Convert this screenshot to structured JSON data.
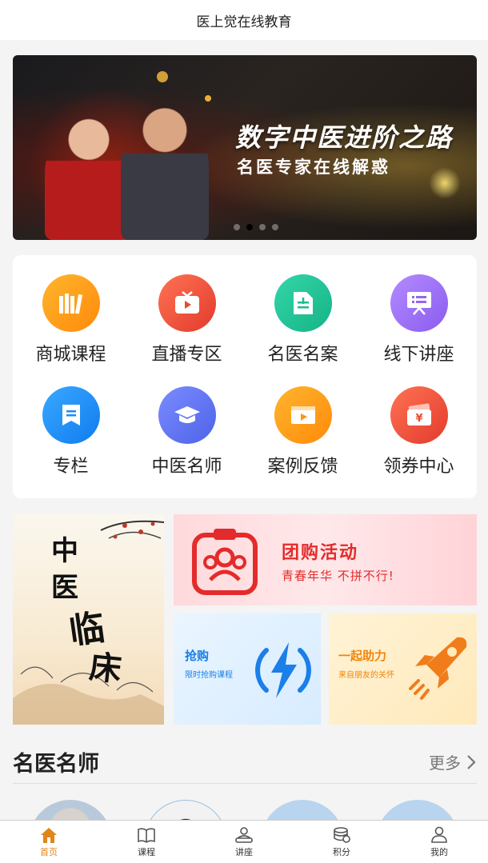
{
  "header": {
    "title": "医上觉在线教育"
  },
  "banner": {
    "line1": "数字中医进阶之路",
    "line2": "名医专家在线解惑",
    "slide_count": 4,
    "active_slide": 2
  },
  "menu": {
    "items": [
      {
        "label": "商城课程",
        "icon": "books-icon",
        "color": "#ff9e1b"
      },
      {
        "label": "直播专区",
        "icon": "tv-icon",
        "color": "#f0553d"
      },
      {
        "label": "名医名案",
        "icon": "document-icon",
        "color": "#22c49a"
      },
      {
        "label": "线下讲座",
        "icon": "presentation-icon",
        "color": "#9b6cf0"
      },
      {
        "label": "专栏",
        "icon": "column-icon",
        "color": "#1e90ff"
      },
      {
        "label": "中医名师",
        "icon": "graduation-cap-icon",
        "color": "#5b72f0"
      },
      {
        "label": "案例反馈",
        "icon": "video-play-icon",
        "color": "#ff9e1b"
      },
      {
        "label": "领券中心",
        "icon": "coupon-icon",
        "color": "#f0553d"
      }
    ]
  },
  "promos": {
    "clinic": {
      "c1": "中",
      "c2": "医",
      "c3": "临",
      "c4": "床"
    },
    "group_buy": {
      "title": "团购活动",
      "subtitle": "青春年华 不拼不行!"
    },
    "flash_sale": {
      "title": "抢购",
      "subtitle": "限时抢购课程"
    },
    "assist": {
      "title": "一起助力",
      "subtitle": "来自朋友的关怀"
    }
  },
  "section": {
    "title": "名医名师",
    "more": "更多"
  },
  "tabbar": {
    "items": [
      {
        "label": "首页",
        "icon": "home-icon",
        "active": true
      },
      {
        "label": "课程",
        "icon": "book-icon",
        "active": false
      },
      {
        "label": "讲座",
        "icon": "lecture-icon",
        "active": false
      },
      {
        "label": "积分",
        "icon": "coins-icon",
        "active": false
      },
      {
        "label": "我的",
        "icon": "user-icon",
        "active": false
      }
    ]
  },
  "colors": {
    "accent": "#e0861a",
    "group_buy_red": "#e42b2b",
    "flash_blue": "#1a7fe8",
    "assist_orange": "#f0860a"
  }
}
